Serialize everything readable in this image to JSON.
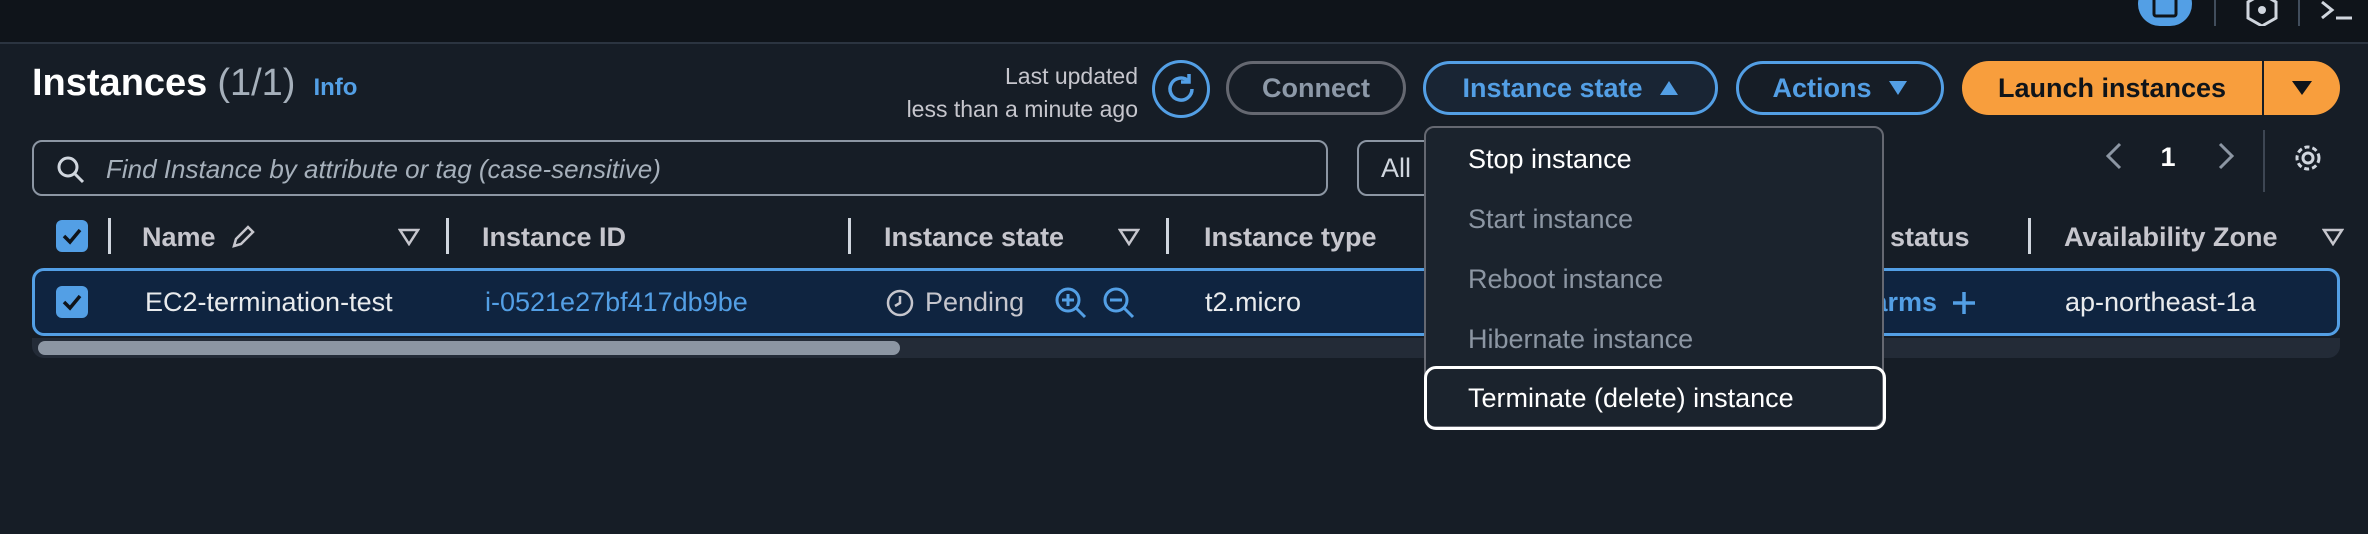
{
  "header": {
    "title": "Instances",
    "count": "(1/1)",
    "info": "Info",
    "last_updated_line1": "Last updated",
    "last_updated_line2": "less than a minute ago"
  },
  "toolbar": {
    "connect_label": "Connect",
    "instance_state_label": "Instance state",
    "actions_label": "Actions",
    "launch_label": "Launch instances"
  },
  "search": {
    "placeholder": "Find Instance by attribute or tag (case-sensitive)",
    "filter_value": "All"
  },
  "pagination": {
    "current_page": "1"
  },
  "table": {
    "columns": [
      "Name",
      "Instance ID",
      "Instance state",
      "Instance type",
      "status",
      "Availability Zone"
    ],
    "rows": [
      {
        "name": "EC2-termination-test",
        "instance_id": "i-0521e27bf417db9be",
        "state": "Pending",
        "type": "t2.micro",
        "alarms": "larms",
        "az": "ap-northeast-1a"
      }
    ]
  },
  "state_menu": {
    "items": [
      {
        "label": "Stop instance",
        "enabled": true
      },
      {
        "label": "Start instance",
        "enabled": false
      },
      {
        "label": "Reboot instance",
        "enabled": false
      },
      {
        "label": "Hibernate instance",
        "enabled": false
      },
      {
        "label": "Terminate (delete) instance",
        "enabled": true
      }
    ]
  },
  "colors": {
    "background": "#161d26",
    "link": "#539fe5",
    "primary": "#f89e3d",
    "text": "#e9ebed"
  },
  "icons": [
    "settings-icon",
    "refresh-icon",
    "search-icon",
    "pencil-icon",
    "caret-up-icon",
    "caret-down-icon",
    "clock-icon",
    "zoom-in-icon",
    "zoom-out-icon",
    "plus-icon",
    "chevron-left-icon",
    "chevron-right-icon",
    "check-icon"
  ]
}
